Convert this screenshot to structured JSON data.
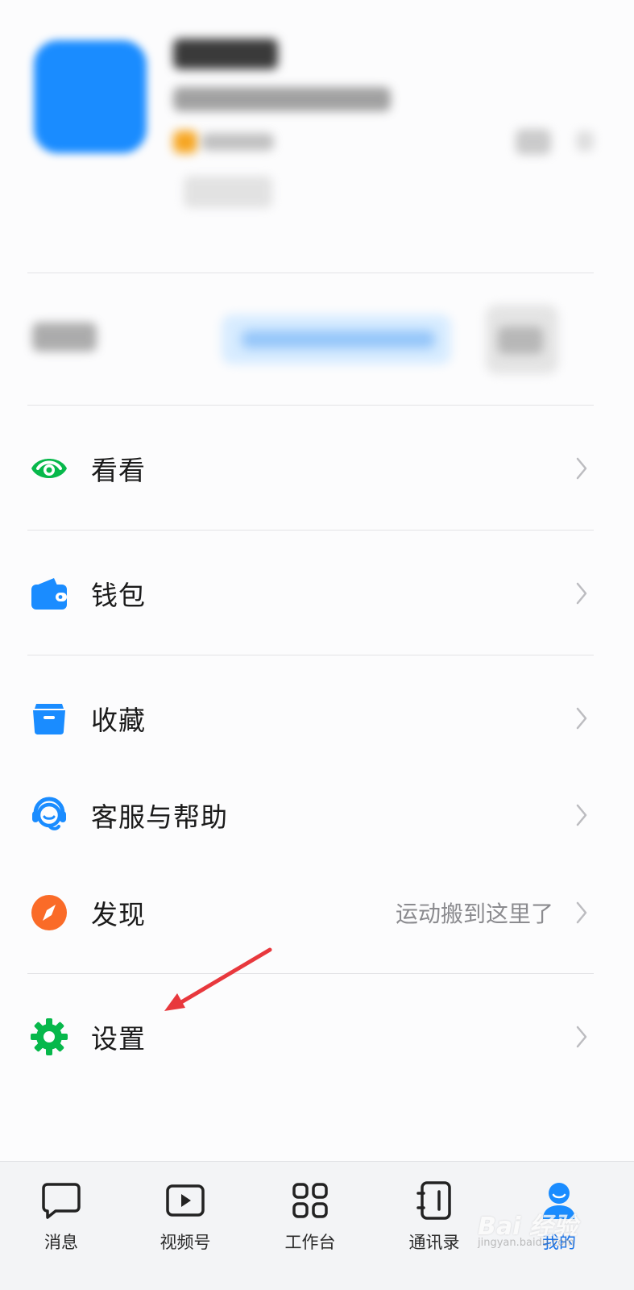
{
  "menu": {
    "items": [
      {
        "id": "kankan",
        "label": "看看",
        "icon": "eye-icon",
        "color": "#07b84b"
      },
      {
        "id": "wallet",
        "label": "钱包",
        "icon": "wallet-icon",
        "color": "#1a8cff"
      },
      {
        "id": "favorites",
        "label": "收藏",
        "icon": "folder-icon",
        "color": "#1a8cff"
      },
      {
        "id": "support",
        "label": "客服与帮助",
        "icon": "headset-icon",
        "color": "#1a8cff"
      },
      {
        "id": "discover",
        "label": "发现",
        "icon": "compass-icon",
        "color": "#fa6b28",
        "extra": "运动搬到这里了"
      },
      {
        "id": "settings",
        "label": "设置",
        "icon": "gear-icon",
        "color": "#07b84b"
      }
    ]
  },
  "tabbar": {
    "tabs": [
      {
        "label": "消息",
        "icon": "message-icon",
        "active": false
      },
      {
        "label": "视频号",
        "icon": "video-play-icon",
        "active": false
      },
      {
        "label": "工作台",
        "icon": "grid-icon",
        "active": false
      },
      {
        "label": "通讯录",
        "icon": "address-book-icon",
        "active": false
      },
      {
        "label": "我的",
        "icon": "person-icon",
        "active": true
      }
    ],
    "active_color": "#1a73e8"
  },
  "watermark": {
    "text": "Bai 经验",
    "sub": "jingyan.baidu.com"
  },
  "colors": {
    "annotation_arrow": "#e8383d"
  }
}
